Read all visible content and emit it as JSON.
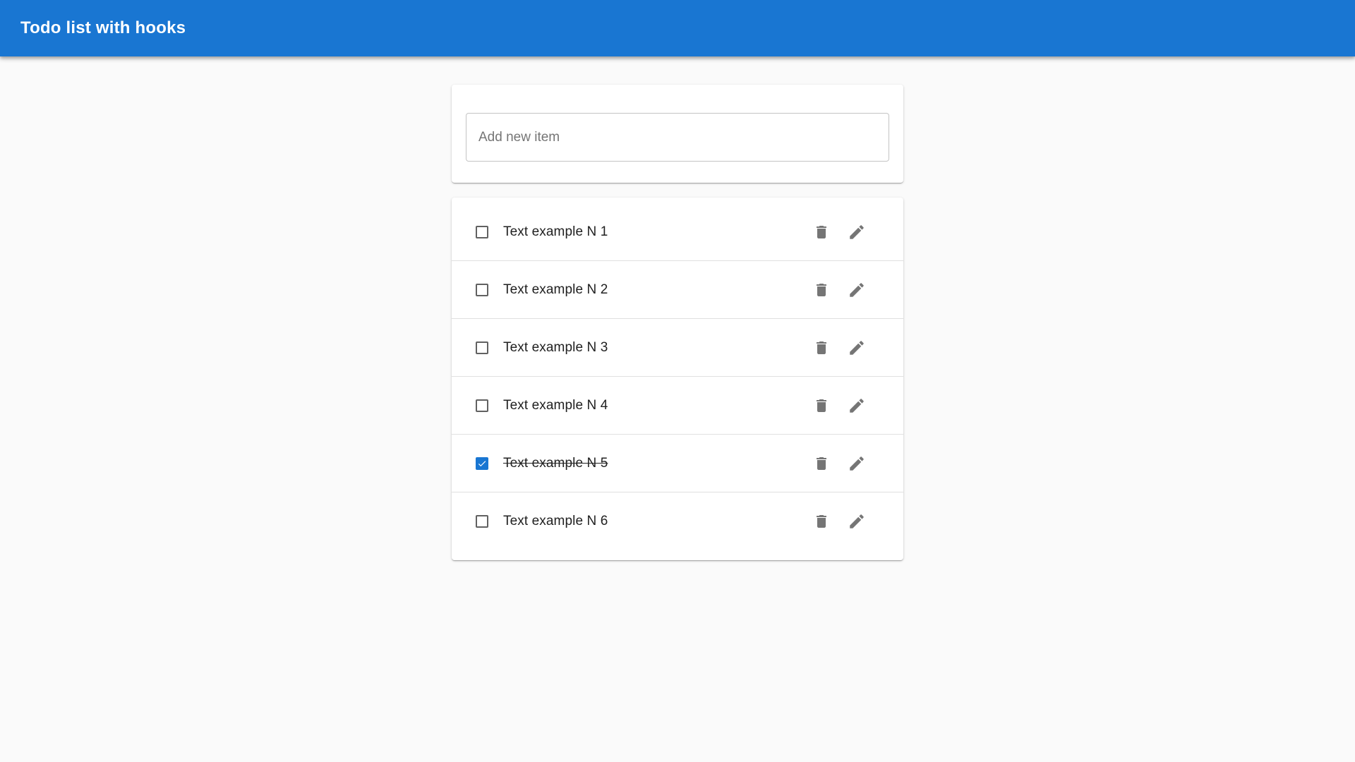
{
  "appbar": {
    "title": "Todo list with hooks",
    "color": "#1976d2"
  },
  "add_item": {
    "placeholder": "Add new item",
    "value": ""
  },
  "todos": [
    {
      "text": "Text example N 1",
      "checked": false
    },
    {
      "text": "Text example N 2",
      "checked": false
    },
    {
      "text": "Text example N 3",
      "checked": false
    },
    {
      "text": "Text example N 4",
      "checked": false
    },
    {
      "text": "Text example N 5",
      "checked": true
    },
    {
      "text": "Text example N 6",
      "checked": false
    }
  ],
  "icons": {
    "delete": "trash-icon",
    "edit": "pencil-icon",
    "check": "check-icon"
  },
  "colors": {
    "accent": "#1976d2",
    "background": "#fafafa",
    "icon": "#757575"
  }
}
